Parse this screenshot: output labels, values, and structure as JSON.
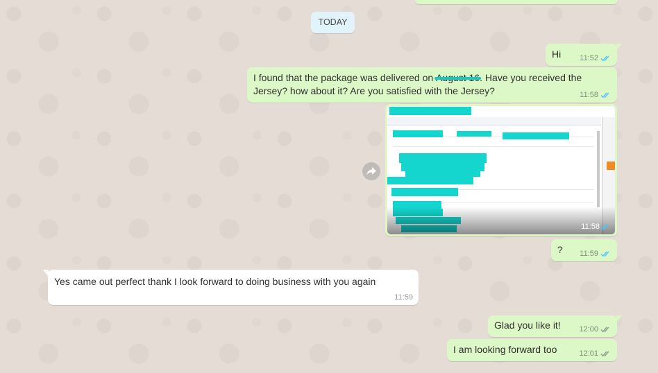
{
  "chat": {
    "date_divider": "TODAY",
    "messages": [
      {
        "text": "Hi",
        "time": "11:52"
      },
      {
        "text_before": "I found that the package was delivered on ",
        "struck": "August 16",
        "text_after": ". Have you received the",
        "text_line2": "Jersey? how about it? Are you satisfied with the Jersey?",
        "time": "11:58"
      },
      {
        "type": "image",
        "time": "11:58"
      },
      {
        "text": "?",
        "time": "11:59"
      },
      {
        "text": "Yes came out perfect thank I look forward to doing business with you again",
        "time": "11:59"
      },
      {
        "text": "Glad you like it!",
        "time": "12:00"
      },
      {
        "text": "I am looking forward too",
        "time": "12:01"
      }
    ]
  },
  "colors": {
    "chat_bg": "#e5ddd5",
    "outgoing_bubble": "#dcf8c6",
    "incoming_bubble": "#ffffff",
    "date_chip": "#e1f3fb",
    "read_ticks": "#4fc3f7",
    "redaction": "#14d6cf"
  },
  "icons": {
    "read_receipt": "double-check-icon",
    "forward": "forward-arrow-icon"
  }
}
